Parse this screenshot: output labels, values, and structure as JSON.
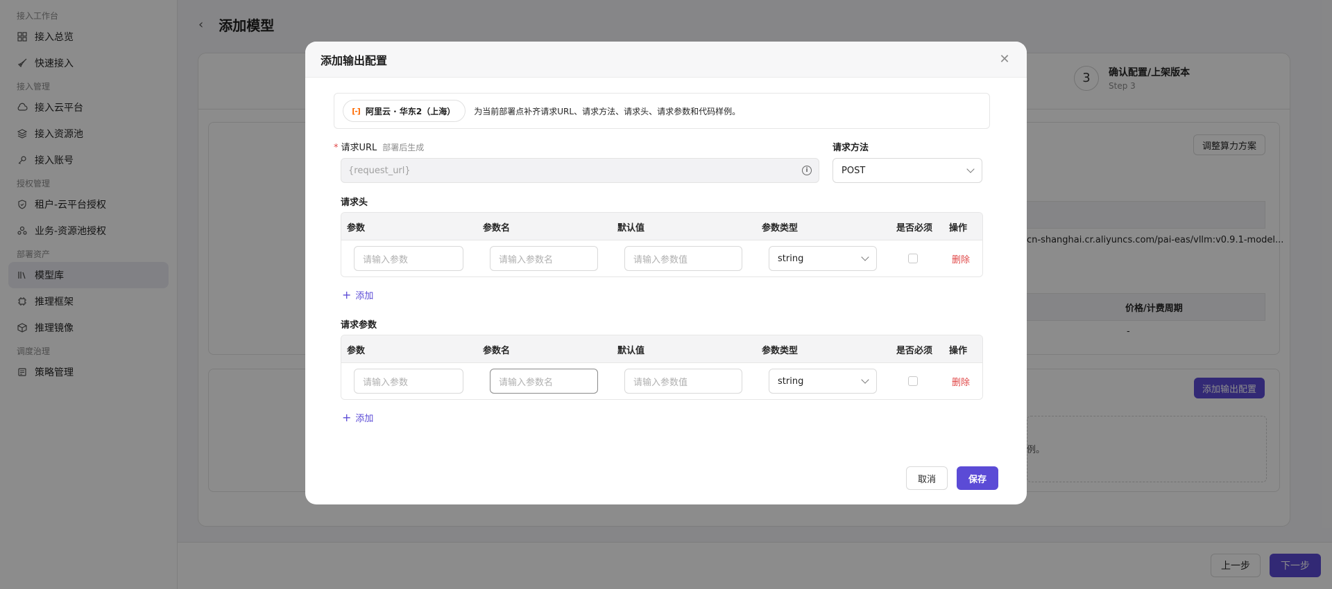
{
  "sidebar": {
    "groups": [
      {
        "title": "接入工作台",
        "items": [
          "接入总览",
          "快速接入"
        ]
      },
      {
        "title": "接入管理",
        "items": [
          "接入云平台",
          "接入资源池",
          "接入账号"
        ]
      },
      {
        "title": "授权管理",
        "items": [
          "租户-云平台授权",
          "业务-资源池授权"
        ]
      },
      {
        "title": "部署资产",
        "items": [
          "模型库",
          "推理框架",
          "推理镜像"
        ]
      },
      {
        "title": "调度治理",
        "items": [
          "策略管理"
        ]
      }
    ],
    "active_item": "模型库"
  },
  "page": {
    "title": "添加模型",
    "step3": {
      "number": "3",
      "title": "确认配置/上架版本",
      "subtitle": "Step 3"
    },
    "adjust_button": "调整算力方案",
    "image_url_fragment": "cn-shanghai.cr.aliyuncs.com/pai-eas/vllm:v0.9.1-model...",
    "price_header": "价格/计费周期",
    "price_value": "-",
    "add_output_button": "添加输出配置",
    "hint_fragment": "例。",
    "prev_button": "上一步",
    "next_button": "下一步"
  },
  "modal": {
    "title": "添加输出配置",
    "region_chip": "阿里云 · 华东2（上海）",
    "info_text": "为当前部署点补齐请求URL、请求方法、请求头、请求参数和代码样例。",
    "url_label": "请求URL",
    "url_hint": "部署后生成",
    "url_placeholder": "{request_url}",
    "method_label": "请求方法",
    "method_value": "POST",
    "headers_section": "请求头",
    "params_section": "请求参数",
    "columns": [
      "参数",
      "参数名",
      "默认值",
      "参数类型",
      "是否必须",
      "操作"
    ],
    "row": {
      "param_placeholder": "请输入参数",
      "name_placeholder": "请输入参数名",
      "default_placeholder": "请输入参数值",
      "type_value": "string",
      "delete_label": "删除"
    },
    "add_label": "添加",
    "cancel_label": "取消",
    "save_label": "保存"
  },
  "colors": {
    "primary": "#5b4bd6",
    "danger": "#e04848",
    "aliyun_orange": "#ff6a00"
  }
}
